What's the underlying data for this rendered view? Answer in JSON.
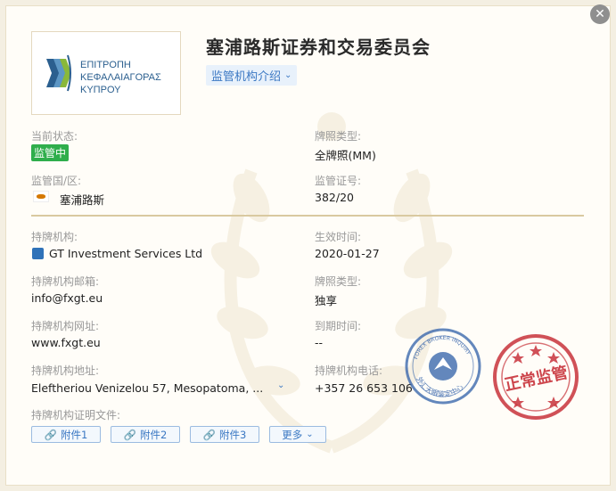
{
  "header": {
    "title": "塞浦路斯证券和交易委员会",
    "intro_label": "监管机构介绍",
    "close_symbol": "✕"
  },
  "logo": {
    "line1": "ΕΠΙΤΡΟΠΗ",
    "line2": "ΚΕΦΑΛΑΙΑΓΟΡΑΣ",
    "line3": "ΚΥΠΡΟΥ"
  },
  "regulation": {
    "status_label": "当前状态:",
    "status_value": "监管中",
    "license_type_label": "牌照类型:",
    "license_type_value": "全牌照(MM)",
    "country_label": "监管国/区:",
    "country_value": "塞浦路斯",
    "license_no_label": "监管证号:",
    "license_no_value": "382/20"
  },
  "holder": {
    "institution_label": "持牌机构:",
    "institution_value": "GT Investment Services Ltd",
    "effective_label": "生效时间:",
    "effective_value": "2020-01-27",
    "email_label": "持牌机构邮箱:",
    "email_value": "info@fxgt.eu",
    "license_type2_label": "牌照类型:",
    "license_type2_value": "独享",
    "website_label": "持牌机构网址:",
    "website_value": "www.fxgt.eu",
    "expiry_label": "到期时间:",
    "expiry_value": "--",
    "address_label": "持牌机构地址:",
    "address_value": "Eleftheriou Venizelou 57, Mesopatoma, ...",
    "phone_label": "持牌机构电话:",
    "phone_value": "+357 26 653 106",
    "docs_label": "持牌机构证明文件:"
  },
  "attachments": {
    "items": [
      "附件1",
      "附件2",
      "附件3"
    ],
    "more_label": "更多"
  },
  "stamps": {
    "blue_ring_text": "FOREX BROKER INQUIRY",
    "blue_bottom_text": "外汇天眼鉴定中心",
    "red_text": "正常监管"
  },
  "colors": {
    "accent_blue": "#3b78c3",
    "status_green": "#2fae4c",
    "stamp_red": "#c8333b",
    "stamp_blue": "#2f5fa8",
    "gold_line": "#d9c9a0"
  }
}
